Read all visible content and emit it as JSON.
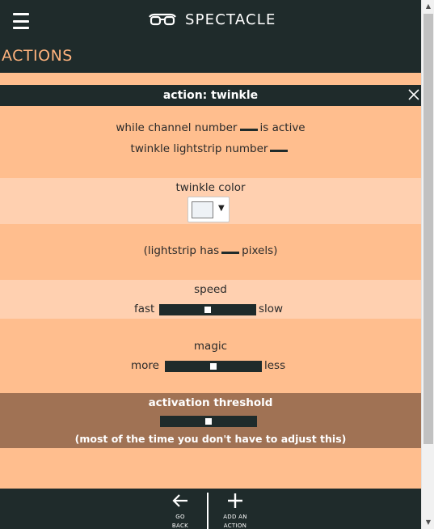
{
  "header": {
    "brand_name": "SPECTACLE",
    "page_title": "ACTIONS"
  },
  "panel": {
    "title": "action: twinkle"
  },
  "trigger": {
    "line1_before": "while channel number",
    "line1_after": "is active",
    "line2": "twinkle lightstrip number"
  },
  "color": {
    "label": "twinkle color",
    "value": "#eef2f6",
    "arrow": "▼"
  },
  "pixels": {
    "before": "(lightstrip has",
    "after": "pixels)"
  },
  "speed": {
    "label": "speed",
    "left": "fast",
    "right": "slow",
    "value": 0.5
  },
  "magic": {
    "label": "magic",
    "left": "more",
    "right": "less",
    "value": 0.5
  },
  "threshold": {
    "label": "activation threshold",
    "note": "(most of the time you don't have to adjust this)",
    "value": 0.5
  },
  "nav": {
    "back_line1": "GO",
    "back_line2": "BACK",
    "add_line1": "ADD AN",
    "add_line2": "ACTION"
  },
  "colors": {
    "dark": "#1f2b2b",
    "accent": "#ffb37d",
    "panel": "#ffbe8e",
    "panel_alt": "#ffd0b0",
    "threshold_bg": "#a07254"
  },
  "icons": {
    "menu": "hamburger-icon",
    "logo": "glasses-logo",
    "close": "close-icon",
    "back": "arrow-left-icon",
    "add": "plus-icon"
  }
}
